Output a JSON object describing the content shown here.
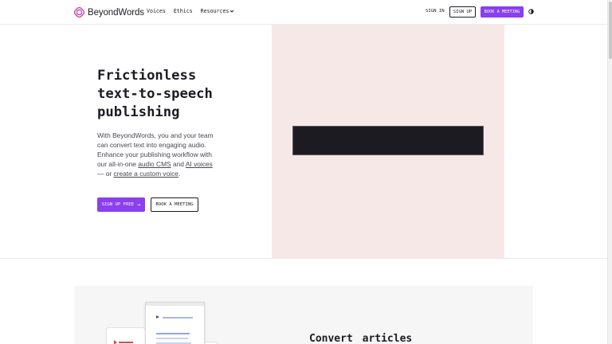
{
  "header": {
    "brand": "BeyondWords",
    "nav": [
      {
        "label": "Voices"
      },
      {
        "label": "Ethics"
      },
      {
        "label": "Resources"
      }
    ],
    "sign_in": "SIGN IN",
    "sign_up": "SIGN UP",
    "book_meeting": "BOOK A MEETING"
  },
  "hero": {
    "title_lines": [
      "Frictionless",
      "text-to-speech",
      "publishing"
    ],
    "body": {
      "line1": "With BeyondWords, you and your team",
      "line2": "can convert text into engaging audio.",
      "line3": "Enhance your publishing workflow with",
      "line4_pre": "our all-in-one ",
      "line4_link1": "audio CMS",
      "line4_mid": " and ",
      "line4_link2": "AI voices",
      "line5_pre": "— or ",
      "line5_link": "create a custom voice",
      "line5_post": "."
    },
    "cta_primary": "SIGN UP FREE",
    "cta_primary_arrow": "→",
    "cta_secondary": "BOOK A MEETING"
  },
  "feature": {
    "heading_words": [
      "Convert",
      "articles"
    ]
  },
  "colors": {
    "accent": "#8a3ff0",
    "hero_panel": "#f7e8e8",
    "dark": "#1d1b22",
    "feature_bg": "#f6f6f6"
  },
  "icons": {
    "logo": "beyondwords-logo-icon",
    "resources_dropdown": "chevron-down-icon",
    "theme": "contrast-icon",
    "cta_arrow": "arrow-right-icon"
  }
}
